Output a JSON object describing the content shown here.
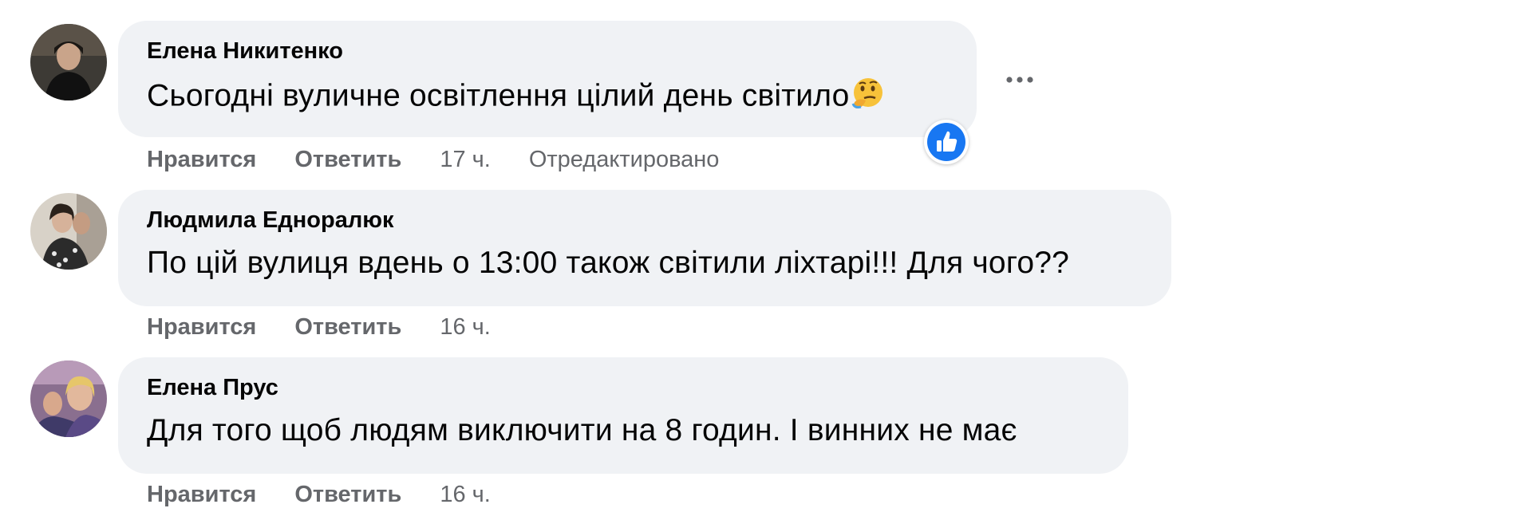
{
  "comments": [
    {
      "author": "Елена Никитенко",
      "text": "Сьогодні вуличне освітлення цілий день світило",
      "emoji": "thinking-face-icon",
      "actions": {
        "like": "Нравится",
        "reply": "Ответить",
        "time": "17 ч.",
        "edited": "Отредактировано"
      },
      "reaction": "like-reaction-icon",
      "has_more_menu": true
    },
    {
      "author": "Людмила Едноралюк",
      "text": "По цій вулиця вдень о 13:00 також світили ліхтарі!!! Для чого??",
      "actions": {
        "like": "Нравится",
        "reply": "Ответить",
        "time": "16 ч."
      }
    },
    {
      "author": "Елена Прус",
      "text": "Для того щоб людям виключити на 8 годин. І винних не має",
      "actions": {
        "like": "Нравится",
        "reply": "Ответить",
        "time": "16 ч."
      }
    }
  ],
  "colors": {
    "bubble": "#f0f2f5",
    "meta": "#65676b",
    "like_blue": "#1877f2",
    "text": "#050505"
  }
}
